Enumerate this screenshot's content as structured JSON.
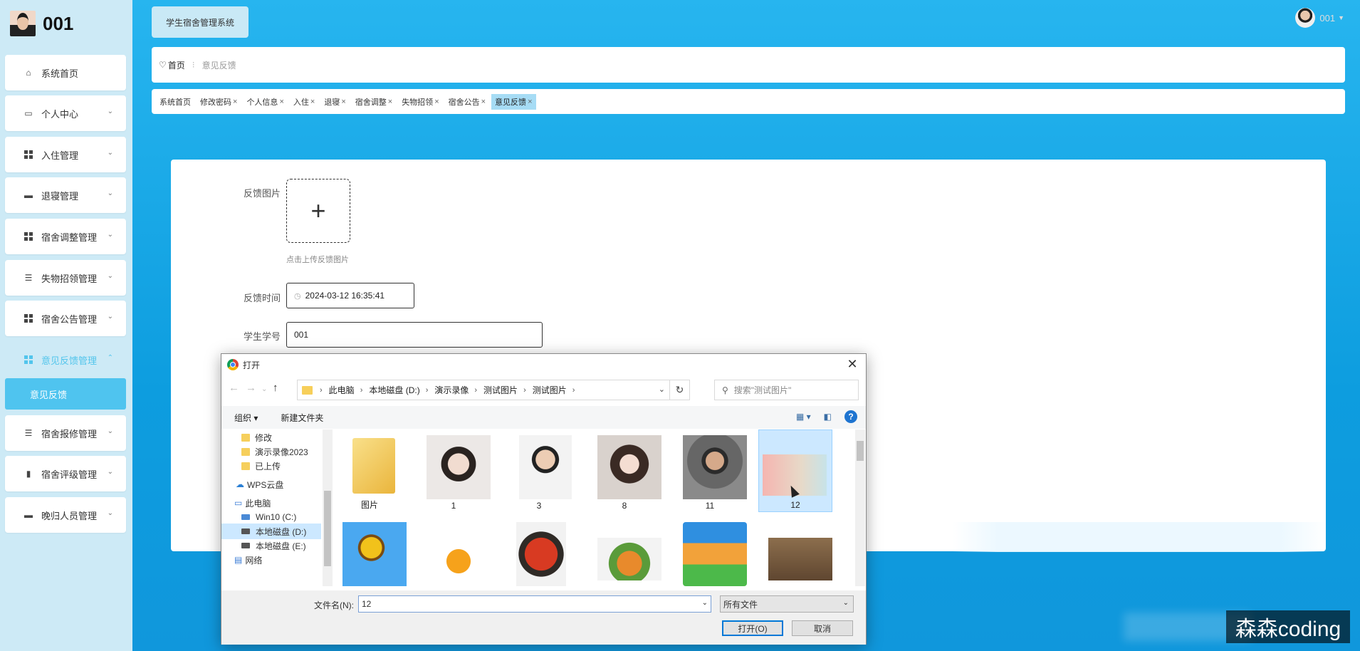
{
  "sidebar": {
    "username": "001",
    "menu": [
      {
        "label": "系统首页",
        "icon": "home-icon",
        "expand": false
      },
      {
        "label": "个人中心",
        "icon": "card-icon",
        "expand": true
      },
      {
        "label": "入住管理",
        "icon": "grid-icon",
        "expand": true
      },
      {
        "label": "退寝管理",
        "icon": "monitor-icon",
        "expand": true
      },
      {
        "label": "宿舍调整管理",
        "icon": "grid-icon",
        "expand": true
      },
      {
        "label": "失物招领管理",
        "icon": "sliders-icon",
        "expand": true
      },
      {
        "label": "宿舍公告管理",
        "icon": "grid-icon",
        "expand": true
      },
      {
        "label": "意见反馈管理",
        "icon": "grid-icon",
        "expand": true,
        "active": true
      },
      {
        "label": "宿舍报修管理",
        "icon": "list-icon",
        "expand": true
      },
      {
        "label": "宿舍评级管理",
        "icon": "bar-chart-icon",
        "expand": true
      },
      {
        "label": "晚归人员管理",
        "icon": "monitor-icon",
        "expand": true
      }
    ],
    "submenu_active": "意见反馈"
  },
  "header": {
    "system_button": "学生宿舍管理系统",
    "user": "001"
  },
  "breadcrumb": {
    "home": "首页",
    "current": "意见反馈"
  },
  "tabs": [
    {
      "label": "系统首页",
      "closable": false
    },
    {
      "label": "修改密码",
      "closable": true
    },
    {
      "label": "个人信息",
      "closable": true
    },
    {
      "label": "入住",
      "closable": true
    },
    {
      "label": "退寝",
      "closable": true
    },
    {
      "label": "宿舍调整",
      "closable": true
    },
    {
      "label": "失物招领",
      "closable": true
    },
    {
      "label": "宿舍公告",
      "closable": true
    },
    {
      "label": "意见反馈",
      "closable": true,
      "active": true
    }
  ],
  "form": {
    "image_label": "反馈图片",
    "upload_hint": "点击上传反馈图片",
    "time_label": "反馈时间",
    "time_value": "2024-03-12 16:35:41",
    "student_label": "学生学号",
    "student_value": "001"
  },
  "dialog": {
    "title": "打开",
    "path": [
      "此电脑",
      "本地磁盘 (D:)",
      "演示录像",
      "测试图片",
      "测试图片"
    ],
    "search_placeholder": "搜索\"测试图片\"",
    "toolbar": {
      "organize": "组织 ▾",
      "new_folder": "新建文件夹"
    },
    "tree": [
      "修改",
      "演示录像2023",
      "已上传",
      "WPS云盘",
      "此电脑",
      "Win10 (C:)",
      "本地磁盘 (D:)",
      "本地磁盘 (E:)",
      "网络"
    ],
    "tree_selected": "本地磁盘 (D:)",
    "files": [
      {
        "label": "图片",
        "kind": "folder"
      },
      {
        "label": "1",
        "kind": "photo"
      },
      {
        "label": "3",
        "kind": "photo"
      },
      {
        "label": "8",
        "kind": "photo"
      },
      {
        "label": "11",
        "kind": "photo"
      },
      {
        "label": "12",
        "kind": "photo",
        "selected": true
      },
      {
        "label": "",
        "kind": "photo"
      },
      {
        "label": "",
        "kind": "photo"
      },
      {
        "label": "",
        "kind": "photo"
      },
      {
        "label": "",
        "kind": "photo"
      },
      {
        "label": "",
        "kind": "photo"
      },
      {
        "label": "",
        "kind": "photo"
      }
    ],
    "filename_label": "文件名(N):",
    "filename_value": "12",
    "filetype_value": "所有文件",
    "open_button": "打开(O)",
    "cancel_button": "取消"
  },
  "watermark": "森森coding",
  "colors": {
    "accent": "#4fc4ef",
    "sidebar_bg": "#cdeaf6",
    "main_bg": "#1aa8e8",
    "dialog_primary": "#0078d7"
  }
}
